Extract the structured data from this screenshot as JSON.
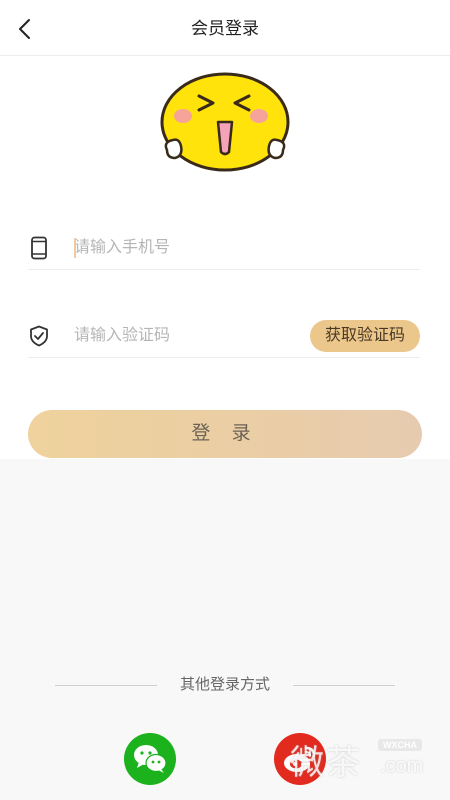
{
  "header": {
    "title": "会员登录",
    "back_icon": "chevron-left-icon"
  },
  "mascot": {
    "icon": "happy-face-mascot"
  },
  "phone_field": {
    "placeholder": "请输入手机号",
    "value": "",
    "icon": "phone-icon"
  },
  "code_field": {
    "placeholder": "请输入验证码",
    "value": "",
    "icon": "shield-check-icon"
  },
  "get_code_button": {
    "label": "获取验证码"
  },
  "login_button": {
    "label": "登 录"
  },
  "other_login": {
    "label": "其他登录方式",
    "methods": [
      {
        "name": "wechat",
        "icon": "wechat-icon",
        "color": "#1bb21e"
      },
      {
        "name": "weibo",
        "icon": "weibo-icon",
        "color": "#e22a1f"
      }
    ]
  },
  "watermark": {
    "text": "微茶",
    "badge": "WXCHA",
    "domain": ".com"
  },
  "colors": {
    "accent": "#ecc78c",
    "login_gradient_start": "#efd29d",
    "login_gradient_end": "#e6cbb0"
  }
}
